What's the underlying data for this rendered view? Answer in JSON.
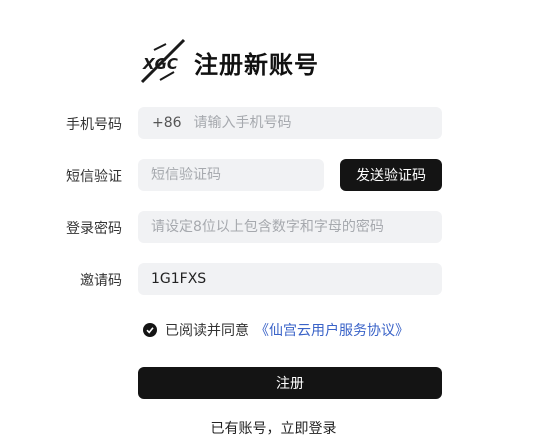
{
  "header": {
    "logo_text": "XGC",
    "title": "注册新账号"
  },
  "form": {
    "phone": {
      "label": "手机号码",
      "prefix": "+86",
      "placeholder": "请输入手机号码",
      "value": ""
    },
    "sms": {
      "label": "短信验证",
      "placeholder": "短信验证码",
      "value": "",
      "send_button": "发送验证码"
    },
    "password": {
      "label": "登录密码",
      "placeholder": "请设定8位以上包含数字和字母的密码",
      "value": ""
    },
    "invite": {
      "label": "邀请码",
      "placeholder": "",
      "value": "1G1FXS"
    }
  },
  "agreement": {
    "checked": true,
    "text": "已阅读并同意",
    "link": "《仙宫云用户服务协议》"
  },
  "submit_label": "注册",
  "login_prompt": {
    "text": "已有账号，",
    "link": "立即登录"
  },
  "colors": {
    "primary": "#141414",
    "link": "#3a63c8",
    "field_bg": "#f1f2f4"
  }
}
